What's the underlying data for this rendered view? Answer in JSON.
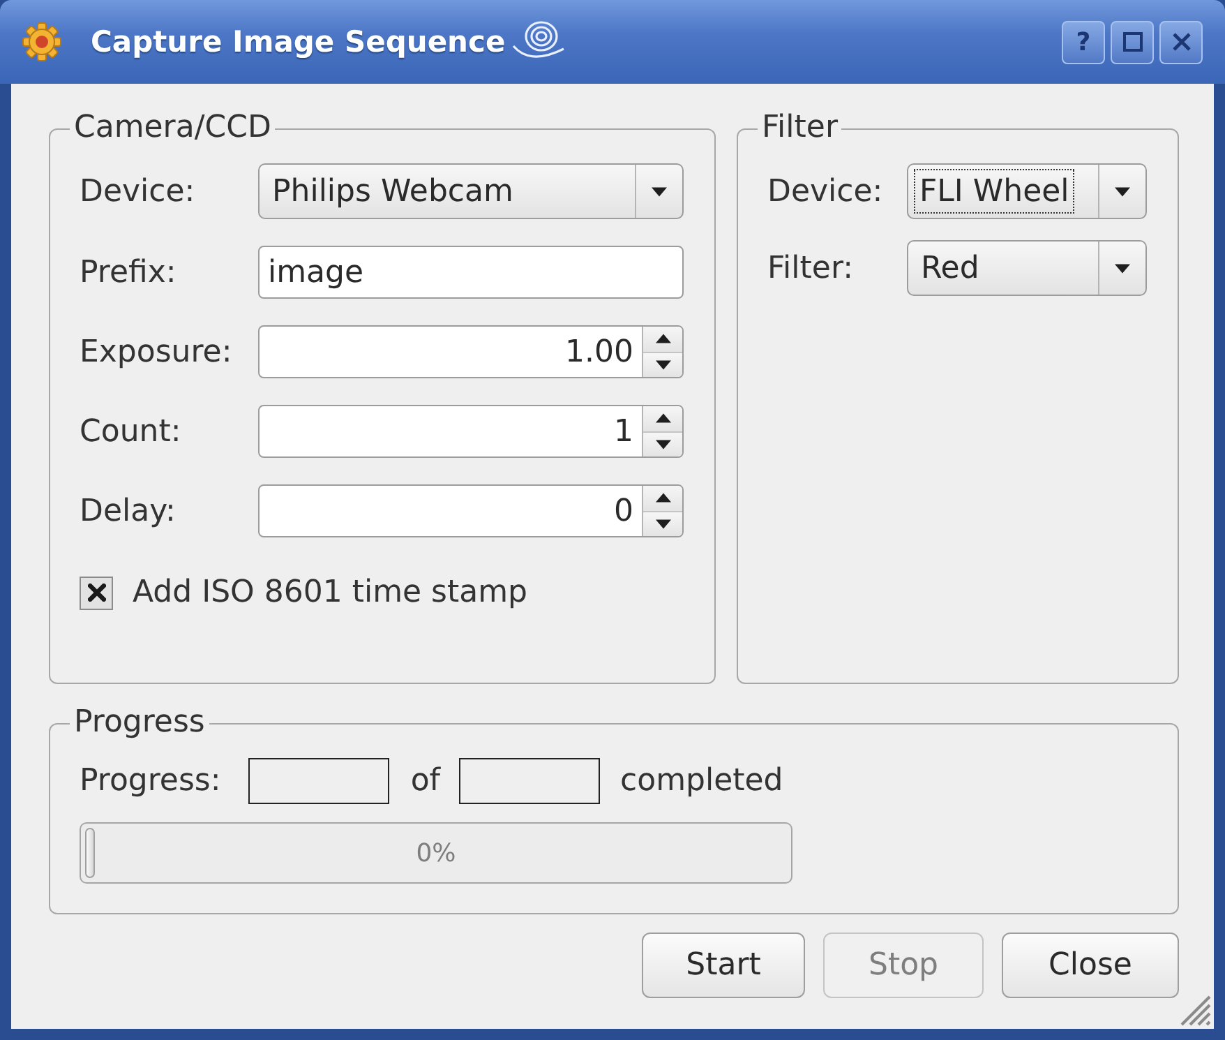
{
  "window": {
    "title": "Capture Image Sequence",
    "buttons": [
      {
        "kind": "help",
        "label": "?"
      },
      {
        "kind": "maximize"
      },
      {
        "kind": "close"
      }
    ]
  },
  "camera": {
    "title": "Camera/CCD",
    "fields": [
      {
        "kind": "combo",
        "label": "Device:",
        "value": "Philips Webcam",
        "focused": false
      },
      {
        "kind": "text",
        "label": "Prefix:",
        "value": "image"
      },
      {
        "kind": "spin",
        "label": "Exposure:",
        "value": "1.00"
      },
      {
        "kind": "spin",
        "label": "Count:",
        "value": "1"
      },
      {
        "kind": "spin",
        "label": "Delay:",
        "value": "0"
      }
    ],
    "timestamp": {
      "label": "Add ISO 8601 time stamp",
      "checked": true
    }
  },
  "filter": {
    "title": "Filter",
    "fields": [
      {
        "kind": "combo",
        "label": "Device:",
        "value": "FLI Wheel",
        "focused": true
      },
      {
        "kind": "combo",
        "label": "Filter:",
        "value": "Red",
        "focused": false
      }
    ]
  },
  "progress": {
    "title": "Progress",
    "label": "Progress:",
    "of": "of",
    "suffix": "completed",
    "bar": {
      "level": 0,
      "text": "0%"
    }
  },
  "buttons": [
    {
      "label": "Start",
      "disabled": false
    },
    {
      "label": "Stop",
      "disabled": true
    },
    {
      "label": "Close",
      "disabled": false
    }
  ]
}
